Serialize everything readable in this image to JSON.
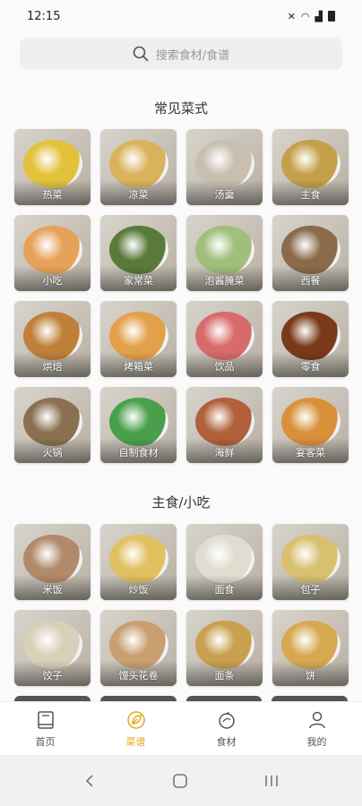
{
  "status": {
    "time": "12:15"
  },
  "search": {
    "placeholder": "搜索食材/食谱"
  },
  "sections": [
    {
      "title": "常见菜式",
      "items": [
        {
          "label": "热菜",
          "color": "#e2c23a"
        },
        {
          "label": "凉菜",
          "color": "#d9b25c"
        },
        {
          "label": "汤羹",
          "color": "#c9bfb0"
        },
        {
          "label": "主食",
          "color": "#c4a04a"
        },
        {
          "label": "小吃",
          "color": "#e7a25a"
        },
        {
          "label": "家常菜",
          "color": "#5a7a3a"
        },
        {
          "label": "泡酱腌菜",
          "color": "#9fbf7a"
        },
        {
          "label": "西餐",
          "color": "#8a6a4a"
        },
        {
          "label": "烘焙",
          "color": "#c0803a"
        },
        {
          "label": "烤箱菜",
          "color": "#e2a04a"
        },
        {
          "label": "饮品",
          "color": "#d86a6a"
        },
        {
          "label": "零食",
          "color": "#7a3a1a"
        },
        {
          "label": "火锅",
          "color": "#8a7050"
        },
        {
          "label": "自制食材",
          "color": "#4aa04a"
        },
        {
          "label": "海鲜",
          "color": "#b0603a"
        },
        {
          "label": "宴客菜",
          "color": "#d8903a"
        }
      ]
    },
    {
      "title": "主食/小吃",
      "items": [
        {
          "label": "米饭",
          "color": "#b08a6a"
        },
        {
          "label": "炒饭",
          "color": "#e0c060"
        },
        {
          "label": "面食",
          "color": "#e0dcd0"
        },
        {
          "label": "包子",
          "color": "#d8c070"
        },
        {
          "label": "饺子",
          "color": "#d8d0b8"
        },
        {
          "label": "馒头花卷",
          "color": "#c8a070"
        },
        {
          "label": "面条",
          "color": "#c8a050"
        },
        {
          "label": "饼",
          "color": "#d8a850"
        }
      ]
    }
  ],
  "tabs": [
    {
      "label": "首页",
      "icon": "book-icon",
      "active": false
    },
    {
      "label": "菜谱",
      "icon": "leaf-icon",
      "active": true
    },
    {
      "label": "食材",
      "icon": "ingredient-icon",
      "active": false
    },
    {
      "label": "我的",
      "icon": "person-icon",
      "active": false
    }
  ],
  "colors": {
    "accent": "#e6a817"
  }
}
